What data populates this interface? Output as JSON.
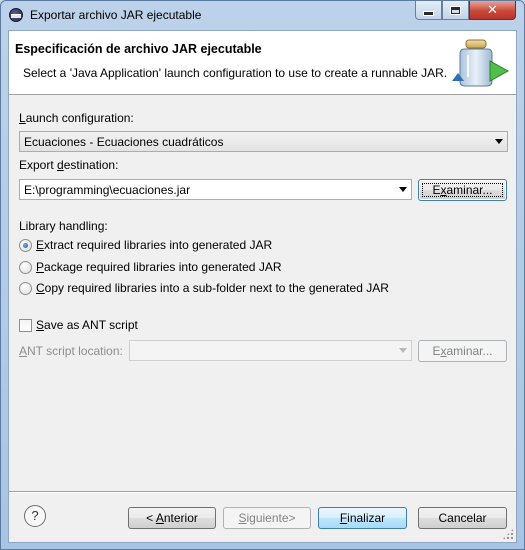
{
  "window": {
    "title": "Exportar archivo JAR ejecutable",
    "buttons": {
      "minimize": "",
      "maximize": "",
      "close": "✕"
    }
  },
  "header": {
    "title": "Especificación de archivo JAR ejecutable",
    "description": "Select a 'Java Application' launch configuration to use to create a runnable JAR.",
    "icon": "jar-export-icon"
  },
  "launch": {
    "label_prefix": "",
    "label_accel": "L",
    "label_rest": "aunch configuration:",
    "value": "Ecuaciones - Ecuaciones cuadráticos"
  },
  "export": {
    "label_prefix": "Export ",
    "label_accel": "d",
    "label_rest": "estination:",
    "value": "E:\\programming\\ecuaciones.jar",
    "browse_accel": "x",
    "browse_prefix": "E",
    "browse_rest": "aminar..."
  },
  "library": {
    "label": "Library handling:",
    "options": [
      {
        "accel": "E",
        "rest": "xtract required libraries into generated JAR",
        "checked": true
      },
      {
        "accel": "P",
        "rest": "ackage required libraries into generated JAR",
        "checked": false
      },
      {
        "accel": "C",
        "rest": "opy required libraries into a sub-folder next to the generated JAR",
        "checked": false
      }
    ]
  },
  "ant": {
    "checkbox_accel": "S",
    "checkbox_rest": "ave as ANT script",
    "checked": false,
    "location_accel": "A",
    "location_rest": "NT script location:",
    "value": "",
    "browse_prefix": "E",
    "browse_accel": "x",
    "browse_rest": "aminar..."
  },
  "footer": {
    "help_icon": "?",
    "back_prefix": "< ",
    "back_accel": "A",
    "back_rest": "nterior",
    "next_accel": "S",
    "next_rest": "iguiente>",
    "finish_accel": "F",
    "finish_rest": "inalizar",
    "cancel": "Cancelar"
  }
}
